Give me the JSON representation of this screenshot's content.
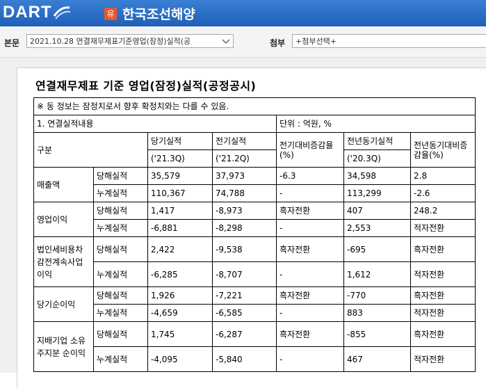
{
  "header": {
    "logo_text": "DART",
    "company_badge": "유",
    "company_name": "한국조선해양"
  },
  "filter": {
    "body_label": "본문",
    "body_select": "2021.10.28  연결재무제표기준영업(잠정)실적(공",
    "attach_label": "첨부",
    "attach_select": "+첨부선택+"
  },
  "document": {
    "title": "연결재무제표 기준 영업(잠정)실적(공정공시)",
    "notice": "※ 동 정보는 잠정치로서 향후 확정치와는 다를 수 있음.",
    "section": "1. 연결실적내용",
    "unit": "단위 : 억원, %",
    "col_header": "구분",
    "headers": {
      "cur": "당기실적",
      "cur_period": "('21.3Q)",
      "prev": "전기실적",
      "prev_period": "('21.2Q)",
      "qoq": "전기대비증감율(%)",
      "yoy_base": "전년동기실적",
      "yoy_period": "('20.3Q)",
      "yoy": "전년동기대비증감율(%)"
    },
    "groups": [
      {
        "name": "매출액",
        "rows": [
          {
            "type": "당해실적",
            "cur": "35,579",
            "prev": "37,973",
            "qoq": "-6.3",
            "base": "34,598",
            "yoy": "2.8"
          },
          {
            "type": "누계실적",
            "cur": "110,367",
            "prev": "74,788",
            "qoq": "-",
            "base": "113,299",
            "yoy": "-2.6"
          }
        ]
      },
      {
        "name": "영업이익",
        "rows": [
          {
            "type": "당해실적",
            "cur": "1,417",
            "prev": "-8,973",
            "qoq": "흑자전환",
            "base": "407",
            "yoy": "248.2"
          },
          {
            "type": "누계실적",
            "cur": "-6,881",
            "prev": "-8,298",
            "qoq": "-",
            "base": "2,553",
            "yoy": "적자전환"
          }
        ]
      },
      {
        "name": "법인세비용차감전계속사업이익",
        "rows": [
          {
            "type": "당해실적",
            "cur": "2,422",
            "prev": "-9,538",
            "qoq": "흑자전환",
            "base": "-695",
            "yoy": "흑자전환"
          },
          {
            "type": "누계실적",
            "cur": "-6,285",
            "prev": "-8,707",
            "qoq": "-",
            "base": "1,612",
            "yoy": "적자전환"
          }
        ]
      },
      {
        "name": "당기순이익",
        "rows": [
          {
            "type": "당해실적",
            "cur": "1,926",
            "prev": "-7,221",
            "qoq": "흑자전환",
            "base": "-770",
            "yoy": "흑자전환"
          },
          {
            "type": "누계실적",
            "cur": "-4,659",
            "prev": "-6,585",
            "qoq": "-",
            "base": "883",
            "yoy": "적자전환"
          }
        ]
      },
      {
        "name": "지배기업 소유주지분 순이익",
        "rows": [
          {
            "type": "당해실적",
            "cur": "1,745",
            "prev": "-6,287",
            "qoq": "흑자전환",
            "base": "-855",
            "yoy": "흑자전환"
          },
          {
            "type": "누계실적",
            "cur": "-4,095",
            "prev": "-5,840",
            "qoq": "-",
            "base": "467",
            "yoy": "적자전환"
          }
        ]
      }
    ]
  }
}
